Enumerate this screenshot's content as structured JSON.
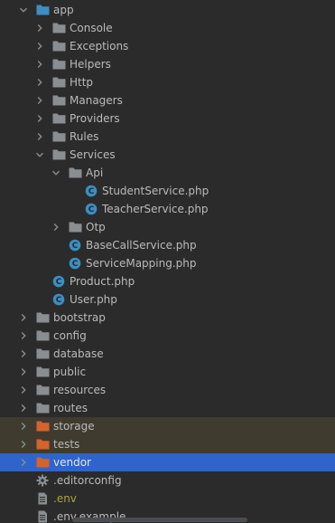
{
  "tree": [
    {
      "label": "app",
      "depth": 1,
      "type": "folder",
      "state": "open",
      "color": "#3d8ec0"
    },
    {
      "label": "Console",
      "depth": 2,
      "type": "folder",
      "state": "closed"
    },
    {
      "label": "Exceptions",
      "depth": 2,
      "type": "folder",
      "state": "closed"
    },
    {
      "label": "Helpers",
      "depth": 2,
      "type": "folder",
      "state": "closed"
    },
    {
      "label": "Http",
      "depth": 2,
      "type": "folder",
      "state": "closed"
    },
    {
      "label": "Managers",
      "depth": 2,
      "type": "folder",
      "state": "closed"
    },
    {
      "label": "Providers",
      "depth": 2,
      "type": "folder",
      "state": "closed"
    },
    {
      "label": "Rules",
      "depth": 2,
      "type": "folder",
      "state": "closed"
    },
    {
      "label": "Services",
      "depth": 2,
      "type": "folder",
      "state": "open"
    },
    {
      "label": "Api",
      "depth": 3,
      "type": "folder",
      "state": "open"
    },
    {
      "label": "StudentService.php",
      "depth": 4,
      "type": "php"
    },
    {
      "label": "TeacherService.php",
      "depth": 4,
      "type": "php"
    },
    {
      "label": "Otp",
      "depth": 3,
      "type": "folder",
      "state": "closed"
    },
    {
      "label": "BaseCallService.php",
      "depth": 3,
      "type": "php"
    },
    {
      "label": "ServiceMapping.php",
      "depth": 3,
      "type": "php"
    },
    {
      "label": "Product.php",
      "depth": 2,
      "type": "php"
    },
    {
      "label": "User.php",
      "depth": 2,
      "type": "php"
    },
    {
      "label": "bootstrap",
      "depth": 1,
      "type": "folder",
      "state": "closed"
    },
    {
      "label": "config",
      "depth": 1,
      "type": "folder",
      "state": "closed"
    },
    {
      "label": "database",
      "depth": 1,
      "type": "folder",
      "state": "closed"
    },
    {
      "label": "public",
      "depth": 1,
      "type": "folder",
      "state": "closed"
    },
    {
      "label": "resources",
      "depth": 1,
      "type": "folder",
      "state": "closed"
    },
    {
      "label": "routes",
      "depth": 1,
      "type": "folder",
      "state": "closed"
    },
    {
      "label": "storage",
      "depth": 1,
      "type": "folder",
      "state": "closed",
      "color": "#d5632c",
      "highlight": "excluded"
    },
    {
      "label": "tests",
      "depth": 1,
      "type": "folder",
      "state": "closed",
      "color": "#d5632c",
      "highlight": "excluded"
    },
    {
      "label": "vendor",
      "depth": 1,
      "type": "folder",
      "state": "closed",
      "color": "#d5632c",
      "highlight": "selected"
    },
    {
      "label": ".editorconfig",
      "depth": 1,
      "type": "config"
    },
    {
      "label": ".env",
      "depth": 1,
      "type": "text",
      "text_color": "#a9a53c"
    },
    {
      "label": ".env.example",
      "depth": 1,
      "type": "text"
    }
  ],
  "colors": {
    "background": "#2b2b2b",
    "folder": "#8a8e91",
    "php_badge": "#3d8ec0",
    "excluded_row": "#3f3b2f",
    "selected_row": "#2f65ca",
    "arrow": "#8a8e91"
  }
}
